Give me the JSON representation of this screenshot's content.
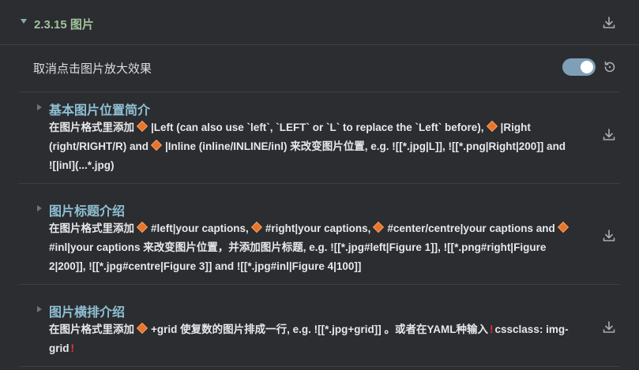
{
  "section": {
    "title": "2.3.15 图片"
  },
  "toggle_row": {
    "label": "取消点击图片放大效果",
    "enabled": true
  },
  "items": [
    {
      "heading": "基本图片位置简介",
      "parts": [
        "在图片格式里添加",
        "|Left (can also use `left`, `LEFT` or `L` to replace the `Left` before),",
        "|Right (right/RIGHT/R) and",
        "|Inline (inline/INLINE/inl) 来改变图片位置, e.g. ![[*.jpg|L]], ![[*.png|Right|200]] and ![|inl](...*.jpg)"
      ]
    },
    {
      "heading": "图片标题介绍",
      "parts": [
        "在图片格式里添加",
        "#left|your captions,",
        "#right|your captions,",
        "#center/centre|your captions and",
        "#inl|your captions 来改变图片位置，并添加图片标题, e.g. ![[*.jpg#left|Figure 1]], ![[*.png#right|Figure 2|200]], ![[*.jpg#centre|Figure 3]] and ![[*.jpg#inl|Figure 4|100]]"
      ]
    },
    {
      "heading": "图片横排介绍",
      "parts": [
        "在图片格式里添加",
        "+grid 使复数的图片排成一行, e.g. ![[*.jpg+grid]] 。或者在YAML种输入",
        "cssclass: img-grid"
      ]
    }
  ],
  "colors": {
    "background": "#2b2d31",
    "section_title": "#9fc39a",
    "item_heading": "#8fc0d4",
    "toggle_on": "#7f9fb7",
    "diamond": "#e8742b",
    "bang": "#e5303a"
  },
  "icons": [
    "download-icon",
    "reset-icon",
    "diamond-icon",
    "exclamation-icon"
  ]
}
